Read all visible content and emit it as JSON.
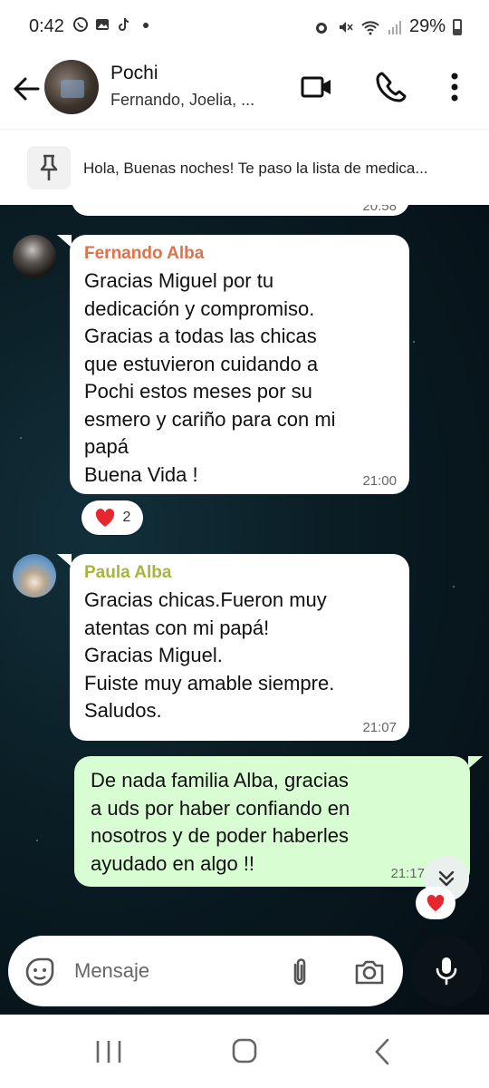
{
  "status_bar": {
    "time": "0:42",
    "battery": "29%"
  },
  "header": {
    "title": "Pochi",
    "subtitle": "Fernando, Joelia, ..."
  },
  "pinned": {
    "text": "Hola, Buenas noches! Te paso la lista de medica..."
  },
  "messages": [
    {
      "sender": "",
      "text": "",
      "time": "20:58"
    },
    {
      "sender": "Fernando Alba",
      "sender_color": "#e2704a",
      "text": "Gracias Miguel por tu\ndedicación y compromiso.\nGracias a todas las chicas\nque estuvieron cuidando a\nPochi estos meses por su\nesmero y cariño para con mi\npapá\nBuena Vida  !",
      "time": "21:00",
      "reaction": {
        "emoji": "❤️",
        "count": "2"
      }
    },
    {
      "sender": "Paula Alba",
      "sender_color": "#a8b43c",
      "text": "Gracias chicas.Fueron muy\natentas con mi papá!\nGracias Miguel.\nFuiste muy amable siempre.\nSaludos.",
      "time": "21:07"
    },
    {
      "sender": "",
      "text": "De nada familia Alba, gracias\na uds por haber confiando en\nnosotros y de poder haberles\nayudado en algo !!",
      "time": "21:17"
    }
  ],
  "input": {
    "placeholder": "Mensaje"
  },
  "colors": {
    "outgoing_bubble": "#d9fdd3",
    "incoming_bubble": "#ffffff",
    "fernando": "#e2704a",
    "paula": "#a8b43c"
  }
}
